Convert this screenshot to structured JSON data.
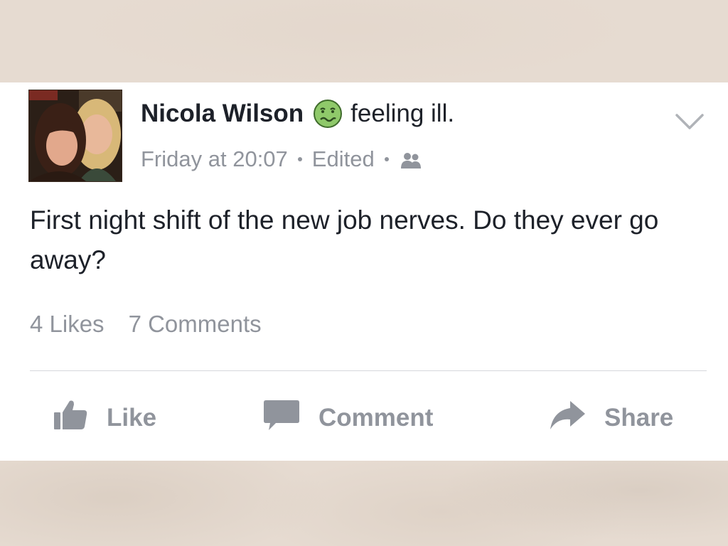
{
  "post": {
    "author": "Nicola Wilson",
    "feeling": "feeling ill.",
    "feeling_icon": "sick-face-icon",
    "timestamp": "Friday at 20:07",
    "edited": "Edited",
    "audience_icon": "friends-icon",
    "text": "First night shift of the new job nerves.  Do they ever go away?",
    "likes": "4 Likes",
    "comments": "7 Comments"
  },
  "actions": {
    "like_label": "Like",
    "comment_label": "Comment",
    "share_label": "Share"
  },
  "colors": {
    "card_background": "#ffffff",
    "page_background": "#e6dbd1",
    "primary_text": "#1d2129",
    "secondary_text": "#90949c",
    "emoji_green": "#8fc96a"
  }
}
